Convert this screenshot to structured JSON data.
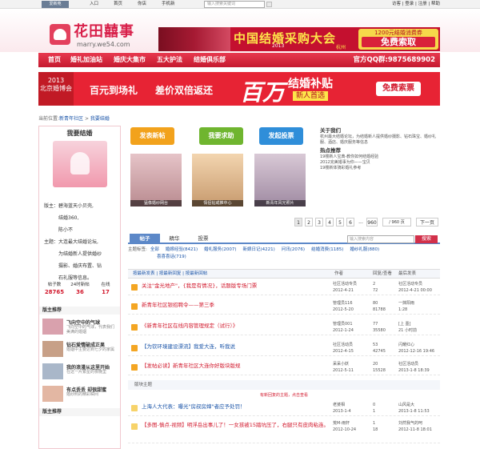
{
  "topbar": {
    "brand": "爱新苑",
    "links": [
      "入口",
      "首页",
      "你店",
      "手机新"
    ],
    "search_placeholder": "输入搜索关键词",
    "right": "访客 | 登录 | 注册 | 帮助"
  },
  "header": {
    "logo_text": "花田囍事",
    "logo_sub": "marry.we54.com",
    "banner_title": "中国结婚采购大会",
    "banner_year": "2013",
    "banner_city": "杭州",
    "offer_top": "1200元结婚消费券",
    "offer_btn": "免费索取"
  },
  "nav": {
    "items": [
      "首页",
      "婚礼加油站",
      "婚庆大集市",
      "五大护法",
      "结婚俱乐部"
    ],
    "qq": "官方QQ群:9875689902"
  },
  "promo": {
    "expo_year": "2013",
    "expo_name": "北京婚博会",
    "s1": "百元到场礼",
    "s2": "差价双倍返还",
    "big": "百万",
    "s3": "结婚补贴",
    "s4": "新人首选",
    "btn": "免费索票"
  },
  "breadcrumb": {
    "prefix": "当前位置:",
    "a": "新青年社区",
    "sep": " > ",
    "b": "我要结婚"
  },
  "sidebar": {
    "title": "我要结婚",
    "info": [
      "版主：碧海蓝天小贝壳,",
      "　　　结婚360,",
      "　　　陈小不",
      "主题：大连最大结婚论坛,",
      "　　　为结婚新人提供婚纱",
      "　　　摄影、婚庆布置、钻",
      "　　　石礼服等信息。"
    ],
    "stats": [
      {
        "label": "帖子数",
        "value": "28765"
      },
      {
        "label": "24时新帖",
        "value": "36"
      },
      {
        "label": "在线",
        "value": "17"
      }
    ],
    "section": "版主推荐",
    "recs": [
      {
        "title": "飞向空中的气球",
        "desc": "飞向空中的气球，代表我们美满的婚姻"
      },
      {
        "title": "钻石爱情破成正果",
        "desc": "婚姻中主要达到七夕的家属"
      },
      {
        "title": "我的浪漫从这里开始",
        "desc": "在这一片繁星的夜晚里"
      },
      {
        "title": "有点丢丢 却很甜蜜",
        "desc": "婚纱照的精彩瞬间"
      }
    ],
    "section2": "版主推荐"
  },
  "actions": [
    {
      "label": "发表新帖",
      "color": "#f2a21c"
    },
    {
      "label": "我要求助",
      "color": "#6fb52f"
    },
    {
      "label": "发起投票",
      "color": "#2f8ed9"
    }
  ],
  "photos": [
    {
      "caption": "猛像婚纱网台"
    },
    {
      "caption": "情侣钻戒推中心"
    },
    {
      "caption": "新青年风光照片"
    }
  ],
  "about": {
    "heading": "关于我们",
    "text": "杭州最大结婚论坛，为结婚新人提供婚纱摄影、钻石珠宝、婚纱礼服、酒店、婚庆服务等信息",
    "hot_heading": "热点推荐",
    "hot": [
      "19楼新人宝典-教你如何结婚经验",
      "2012完美婚事为你——宝贝",
      "19楼新体骑彩婚礼参考"
    ]
  },
  "pager": {
    "pages": [
      "1",
      "2",
      "3",
      "4",
      "5",
      "6",
      "...",
      "960"
    ],
    "jump": "/ 960 页",
    "next": "下一页"
  },
  "tabs": {
    "items": [
      "帖子",
      "精华",
      "投票"
    ],
    "search_placeholder": "输入搜索内容",
    "search_btn": "搜索"
  },
  "filter": {
    "prefix": "主题标签:",
    "tags": [
      "全部",
      "婚嫁经验(8421)",
      "婚礼服务(2007)",
      "新娘日记(4221)",
      "问讯(2076)",
      "结婚消费(1185)",
      "婚纱礼服(880)",
      "喜喜喜话(719)"
    ]
  },
  "thead": {
    "c1": "按最新发表 | 按最新回复 | 按最新回帖",
    "c2": "作者",
    "c3": "回复/查看",
    "c4": "最后发表"
  },
  "rows": [
    {
      "title": "关注\"金光地产\"，{我是有情况}，话题版专场门票",
      "color": "#d21a2e",
      "author": "社区活动专员",
      "date": "2012-4-21",
      "reply": "2",
      "view": "72",
      "last": "社区活动专员",
      "lastdate": "2012-4-21 00:00"
    },
    {
      "title": "新青年社区银招聘令——第三季",
      "color": "#d21a2e",
      "author": "管理员116",
      "date": "2012-5-20",
      "reply": "80",
      "view": "81788",
      "last": "一抹阳雨",
      "lastdate": "1:28"
    },
    {
      "title": "《新青年社区在线内容管理规定（试行）》",
      "color": "#d21a2e",
      "author": "管理员001",
      "date": "2012-1-24",
      "reply": "77",
      "view": "35580",
      "last": "[上 墨]",
      "lastdate": "21 小时前"
    },
    {
      "title": "【为钦环境建设漂流】我爱大连，听我说",
      "color": "#1a54a8",
      "author": "社区活动员",
      "date": "2012-4-15",
      "reply": "53",
      "view": "42745",
      "last": "闪耀红心",
      "lastdate": "2012-12-16 19:46"
    },
    {
      "title": "【发帖必读】新青年社区大连你好版块版规",
      "color": "#d21a2e",
      "author": "呆呆小妖",
      "date": "2012-5-11",
      "reply": "20",
      "view": "15528",
      "last": "社区活动员",
      "lastdate": "2013-1-8 18:39"
    },
    {
      "title": "上海人大代表：曝光\"房叔房婶\"者应予处罚！",
      "color": "#1a54a8",
      "author": "老婆相",
      "date": "2013-1-4",
      "reply": "0",
      "view": "1",
      "last": "山风是大",
      "lastdate": "2013-1-8 11:53"
    },
    {
      "title": "【多图-慎点-视频】明浮岳出事儿了！一女孩被15踏坑压了，右腿只有皮肉粘连。",
      "color": "#d21a2e",
      "author": "荒M-雨轩",
      "date": "2012-10-24",
      "reply": "1",
      "view": "18",
      "last": "刘然我气的呵",
      "lastdate": "2012-11-8 18:01"
    }
  ],
  "sep": "版块主题",
  "sep2": "有新回复的主题，点击查看"
}
